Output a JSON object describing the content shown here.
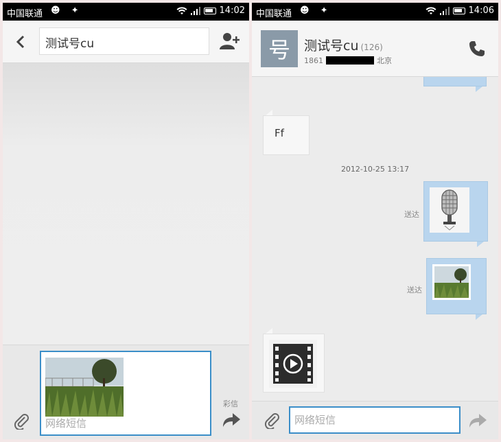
{
  "screen1": {
    "status": {
      "carrier": "中国联通",
      "time": "14:02"
    },
    "recipient": "测试号cu",
    "compose": {
      "placeholder": "网络短信",
      "mms_label": "彩信"
    }
  },
  "screen2": {
    "status": {
      "carrier": "中国联通",
      "time": "14:06"
    },
    "contact": {
      "avatar_char": "号",
      "name": "测试号cu",
      "count": "(126)",
      "number_prefix": "1861",
      "location": "北京"
    },
    "messages": {
      "incoming_text": "Ff",
      "timestamp": "2012-10-25 13:17",
      "delivered_1": "送达",
      "delivered_2": "送达"
    },
    "compose": {
      "placeholder": "网络短信"
    }
  },
  "colors": {
    "accent": "#3a8ec8",
    "outgoing_bubble": "#b9d5ee",
    "avatar_bg": "#8a9aa8"
  }
}
